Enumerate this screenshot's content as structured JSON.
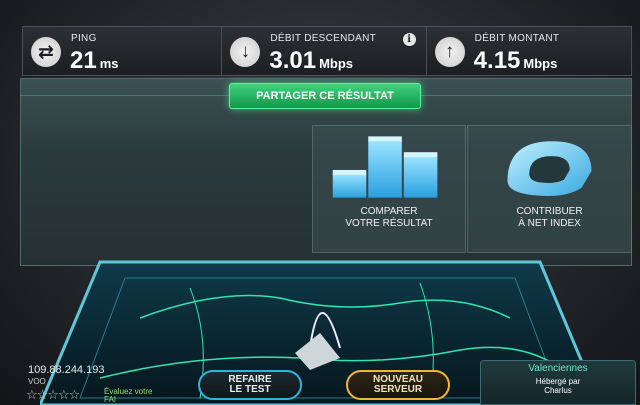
{
  "metrics": {
    "ping": {
      "label": "PING",
      "value": "21",
      "unit": "ms",
      "icon": "swap-arrows-icon"
    },
    "download": {
      "label": "DÉBIT DESCENDANT",
      "value": "3.01",
      "unit": "Mbps",
      "icon": "arrow-down-icon",
      "info": "i"
    },
    "upload": {
      "label": "DÉBIT MONTANT",
      "value": "4.15",
      "unit": "Mbps",
      "icon": "arrow-up-icon"
    }
  },
  "share": {
    "label": "PARTAGER CE RÉSULTAT"
  },
  "tiles": {
    "compare": {
      "line1": "COMPARER",
      "line2": "VOTRE RÉSULTAT"
    },
    "contribute": {
      "line1": "CONTRIBUER",
      "line2": "À NET INDEX"
    }
  },
  "client": {
    "ip": "109.88.244.193",
    "isp": "VOO",
    "stars": "☆☆☆☆☆",
    "rate_line1": "Évaluez votre",
    "rate_line2": "FAI"
  },
  "actions": {
    "retest_line1": "REFAIRE",
    "retest_line2": "LE TEST",
    "newserver_line1": "NOUVEAU",
    "newserver_line2": "SERVEUR"
  },
  "server": {
    "city": "Valenciennes",
    "hosted_line1": "Hébergé par",
    "hosted_line2": "Charlus"
  },
  "colors": {
    "accent_green": "#3fd37d",
    "accent_blue": "#2fb4d9",
    "accent_orange": "#f0b63a",
    "map_line": "#2fe6b0"
  }
}
